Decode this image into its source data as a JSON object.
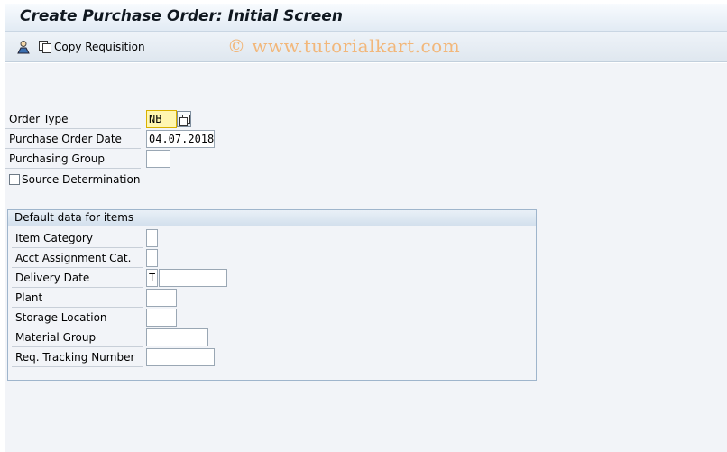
{
  "window": {
    "title": "Create Purchase Order: Initial Screen"
  },
  "toolbar": {
    "copy_requisition_label": "Copy Requisition",
    "watermark": "© www.tutorialkart.com"
  },
  "header_fields": {
    "order_type": {
      "label": "Order Type",
      "value": "NB"
    },
    "po_date": {
      "label": "Purchase Order Date",
      "value": "04.07.2018"
    },
    "purchasing_group": {
      "label": "Purchasing Group",
      "value": ""
    },
    "source_determination": {
      "label": "Source Determination",
      "checked": false
    }
  },
  "default_data": {
    "title": "Default data for items",
    "item_category": {
      "label": "Item Category",
      "value": ""
    },
    "acct_assignment": {
      "label": "Acct Assignment Cat.",
      "value": ""
    },
    "delivery_date": {
      "label": "Delivery Date",
      "format": "T",
      "value": ""
    },
    "plant": {
      "label": "Plant",
      "value": ""
    },
    "storage_location": {
      "label": "Storage Location",
      "value": ""
    },
    "material_group": {
      "label": "Material Group",
      "value": ""
    },
    "req_tracking_number": {
      "label": "Req. Tracking Number",
      "value": ""
    }
  },
  "colors": {
    "required_field_bg": "#fff6b0",
    "group_border": "#9fb5cc",
    "watermark": "#f2b77a"
  }
}
